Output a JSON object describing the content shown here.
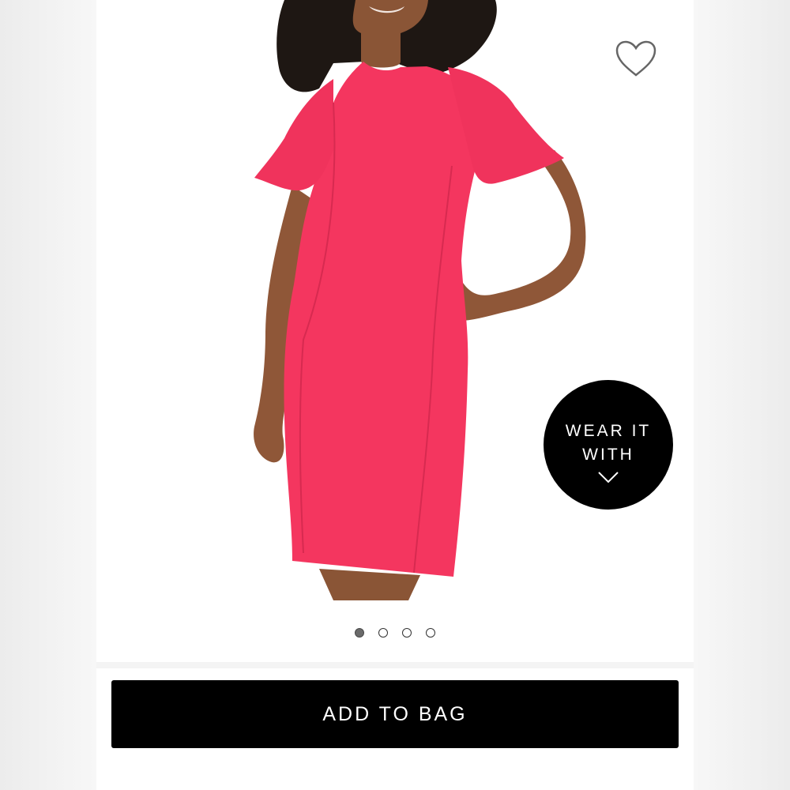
{
  "product": {
    "image_alt": "pink flutter sleeve sheath dress",
    "dress_color": "#f4365f"
  },
  "wishlist": {
    "icon": "heart-outline-icon"
  },
  "wear_it_with": {
    "line1": "WEAR IT",
    "line2": "WITH",
    "icon": "chevron-down-icon"
  },
  "carousel": {
    "total": 4,
    "active_index": 0
  },
  "cta": {
    "add_to_bag_label": "ADD TO BAG"
  }
}
